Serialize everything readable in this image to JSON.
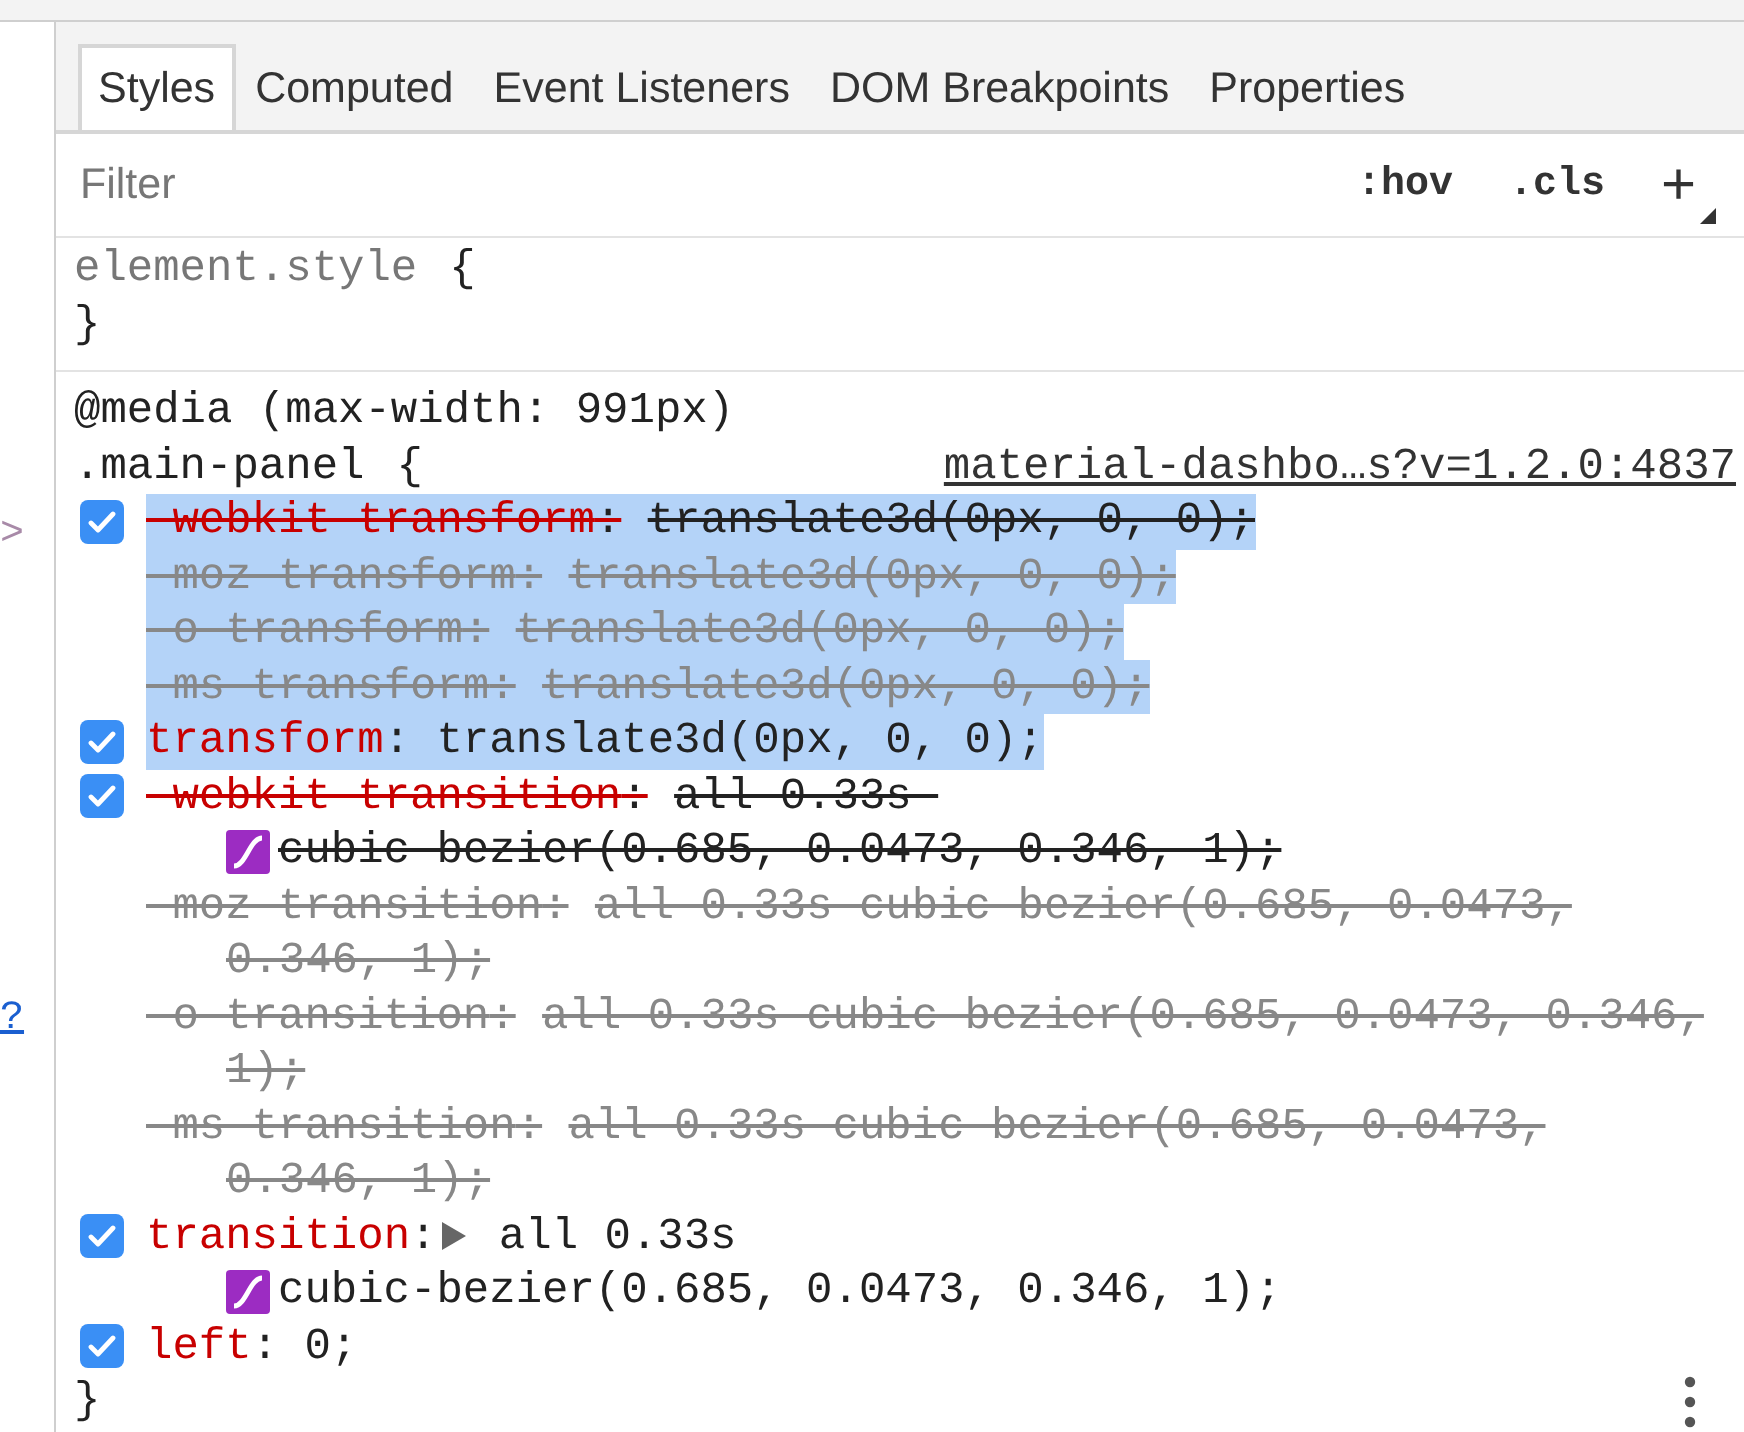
{
  "gutter": [
    {
      "kind": "arrow",
      "text": ">"
    },
    {
      "kind": "link",
      "text": "?"
    }
  ],
  "tabs": [
    {
      "label": "Styles",
      "selected": true
    },
    {
      "label": "Computed",
      "selected": false
    },
    {
      "label": "Event Listeners",
      "selected": false
    },
    {
      "label": "DOM Breakpoints",
      "selected": false
    },
    {
      "label": "Properties",
      "selected": false
    }
  ],
  "toolbar": {
    "filter": {
      "placeholder": "Filter"
    },
    "buttons": [
      ":hov",
      ".cls",
      "+"
    ]
  },
  "rules": [
    {
      "selector": "element.style",
      "open": "{",
      "close": "}"
    },
    {
      "media": "@media (max-width: 991px)",
      "selector": ".main-panel",
      "open": "{",
      "close": "}",
      "source": "material-dashbo…s?v=1.2.0:4837",
      "properties": [
        {
          "name": "-webkit-transform",
          "colon": ":",
          "value": "translate3d(0px, 0, 0);",
          "checked": true,
          "overridden": true,
          "inactive": false,
          "highlighted": true,
          "expandable": false
        },
        {
          "name": "-moz-transform",
          "colon": ":",
          "value": "translate3d(0px, 0, 0);",
          "overridden": true,
          "inactive": true,
          "highlighted": true,
          "expandable": false
        },
        {
          "name": "-o-transform",
          "colon": ":",
          "value": "translate3d(0px, 0, 0);",
          "overridden": true,
          "inactive": true,
          "highlighted": true,
          "expandable": false
        },
        {
          "name": "-ms-transform",
          "colon": ":",
          "value": "translate3d(0px, 0, 0);",
          "overridden": true,
          "inactive": true,
          "highlighted": true,
          "expandable": false
        },
        {
          "name": "transform",
          "colon": ":",
          "value": "translate3d(0px, 0, 0);",
          "checked": true,
          "overridden": false,
          "inactive": false,
          "highlighted": true,
          "expandable": false
        },
        {
          "name": "-webkit-transition",
          "colon": ":",
          "value": "all 0.33s ",
          "checked": true,
          "overridden": true,
          "inactive": false,
          "highlighted": false,
          "expandable": false,
          "continuation": {
            "text": "cubic-bezier(0.685, 0.0473, 0.346, 1);",
            "bezier_swatch": true
          }
        },
        {
          "name": "-moz-transition",
          "colon": ":",
          "value": "all 0.33s cubic-bezier(0.685, 0.0473,",
          "overridden": true,
          "inactive": true,
          "highlighted": false,
          "expandable": false,
          "continuation": {
            "text": "0.346, 1);",
            "bezier_swatch": false
          }
        },
        {
          "name": "-o-transition",
          "colon": ":",
          "value": "all 0.33s cubic-bezier(0.685, 0.0473, 0.346,",
          "overridden": true,
          "inactive": true,
          "highlighted": false,
          "expandable": false,
          "continuation": {
            "text": "1);",
            "bezier_swatch": false
          }
        },
        {
          "name": "-ms-transition",
          "colon": ":",
          "value": "all 0.33s cubic-bezier(0.685, 0.0473,",
          "overridden": true,
          "inactive": true,
          "highlighted": false,
          "expandable": false,
          "continuation": {
            "text": "0.346, 1);",
            "bezier_swatch": false
          }
        },
        {
          "name": "transition",
          "colon": ":",
          "value": "all 0.33s",
          "checked": true,
          "overridden": false,
          "inactive": false,
          "highlighted": false,
          "expandable": true,
          "continuation": {
            "text": "cubic-bezier(0.685, 0.0473, 0.346, 1);",
            "bezier_swatch": true
          }
        },
        {
          "name": "left",
          "colon": ":",
          "value": "0;",
          "checked": true,
          "overridden": false,
          "inactive": false,
          "highlighted": false,
          "expandable": false
        }
      ]
    }
  ]
}
